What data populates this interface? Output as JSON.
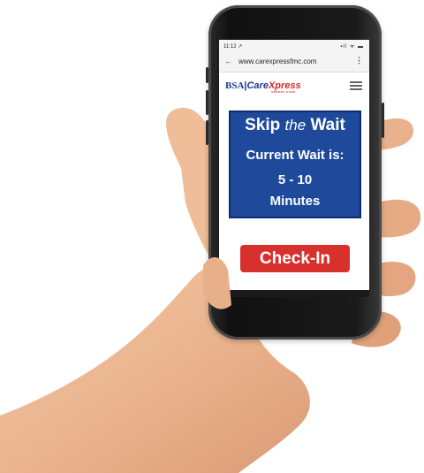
{
  "statusbar": {
    "time": "11:12 ↗",
    "system_icons": "▪ll ᯤ ▬"
  },
  "browser": {
    "back_icon": "arrow-left-icon",
    "url": "www.carexpressfmc.com",
    "menu_icon": "more-vert-icon"
  },
  "site": {
    "logo_bsa": "BSA",
    "logo_care": "Care",
    "logo_xpress": "Xpress",
    "logo_sub": "URGENT CARE",
    "menu_icon": "hamburger-icon"
  },
  "wait_box": {
    "skip": "Skip",
    "the": "the",
    "wait": "Wait",
    "current_wait_label": "Current Wait is:",
    "range": "5 - 10",
    "unit": "Minutes"
  },
  "checkin_button": "Check-In",
  "colors": {
    "brand_blue": "#1f4a9c",
    "brand_red": "#d8302c"
  }
}
